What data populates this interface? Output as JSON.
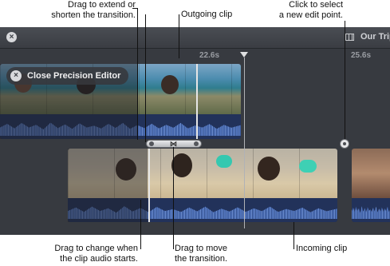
{
  "callouts": {
    "drag_extend": "Drag to extend or\nshorten the transition.",
    "outgoing_clip": "Outgoing clip",
    "click_select": "Click to select\na new edit point.",
    "drag_audio": "Drag to change when\nthe clip audio starts.",
    "drag_move": "Drag to move\nthe transition.",
    "incoming_clip": "Incoming clip"
  },
  "editor": {
    "project_title": "Our Trip",
    "timecode_left": "22.6s",
    "timecode_right": "25.6s",
    "close_precision_label": "Close Precision Editor",
    "transition_glyph": "⋈"
  },
  "icons": {
    "close": "close-icon",
    "project": "film-icon",
    "transition": "bowtie-icon"
  },
  "colors": {
    "editor_bg": "#373a40",
    "audio_wave": "#5a7dc4",
    "pill_bg": "#37383c"
  }
}
